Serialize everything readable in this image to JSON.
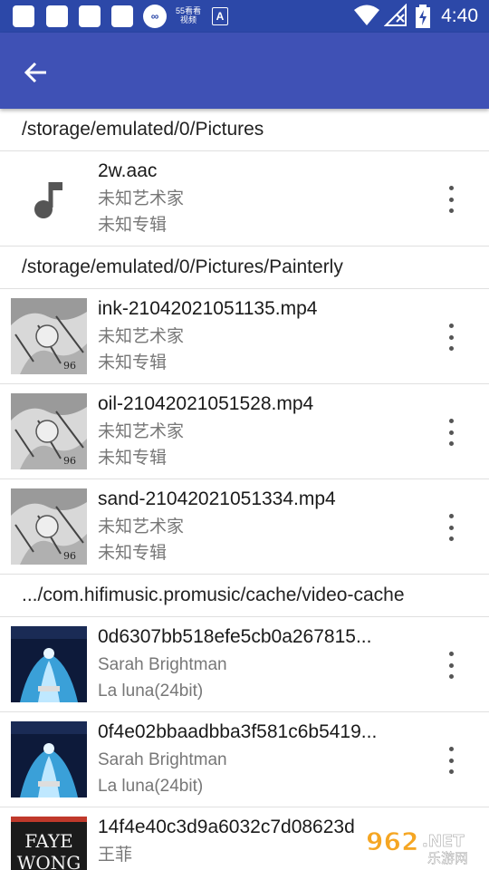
{
  "status_bar": {
    "time": "4:40",
    "left_icons": [
      "notification-icon",
      "notification-icon",
      "notification-icon",
      "notification-icon",
      "infinity-icon",
      "app-badge-icon",
      "a-icon"
    ],
    "badge_text": "55看看\n视频",
    "a_letter": "A",
    "right_icons": [
      "wifi-icon",
      "no-signal-icon",
      "battery-charging-icon"
    ]
  },
  "app_bar": {
    "back_icon": "arrow-back-icon"
  },
  "sections": [
    {
      "path": "/storage/emulated/0/Pictures",
      "items": [
        {
          "title": "2w.aac",
          "artist": "未知艺术家",
          "album": "未知专辑",
          "thumb": "music-note"
        }
      ]
    },
    {
      "path": "/storage/emulated/0/Pictures/Painterly",
      "items": [
        {
          "title": "ink-21042021051135.mp4",
          "artist": "未知艺术家",
          "album": "未知专辑",
          "thumb": "painterly"
        },
        {
          "title": "oil-21042021051528.mp4",
          "artist": "未知艺术家",
          "album": "未知专辑",
          "thumb": "painterly"
        },
        {
          "title": "sand-21042021051334.mp4",
          "artist": "未知艺术家",
          "album": "未知专辑",
          "thumb": "painterly"
        }
      ]
    },
    {
      "path": ".../com.hifimusic.promusic/cache/video-cache",
      "items": [
        {
          "title": "0d6307bb518efe5cb0a267815...",
          "artist": "Sarah Brightman",
          "album": "La luna(24bit)",
          "thumb": "album-blue"
        },
        {
          "title": "0f4e02bbaadbba3f581c6b5419...",
          "artist": "Sarah Brightman",
          "album": "La luna(24bit)",
          "thumb": "album-blue"
        },
        {
          "title": "14f4e40c3d9a6032c7d08623d",
          "artist": "王菲",
          "album": "",
          "thumb": "album-faye",
          "thumb_text": [
            "FAYE",
            "WONG"
          ]
        }
      ]
    }
  ],
  "watermark": {
    "number": "962",
    "domain": ".NET",
    "site": "乐游网"
  },
  "colors": {
    "status_bar": "#2c48a8",
    "app_bar": "#3f51b5",
    "divider": "#e0e0e0"
  }
}
